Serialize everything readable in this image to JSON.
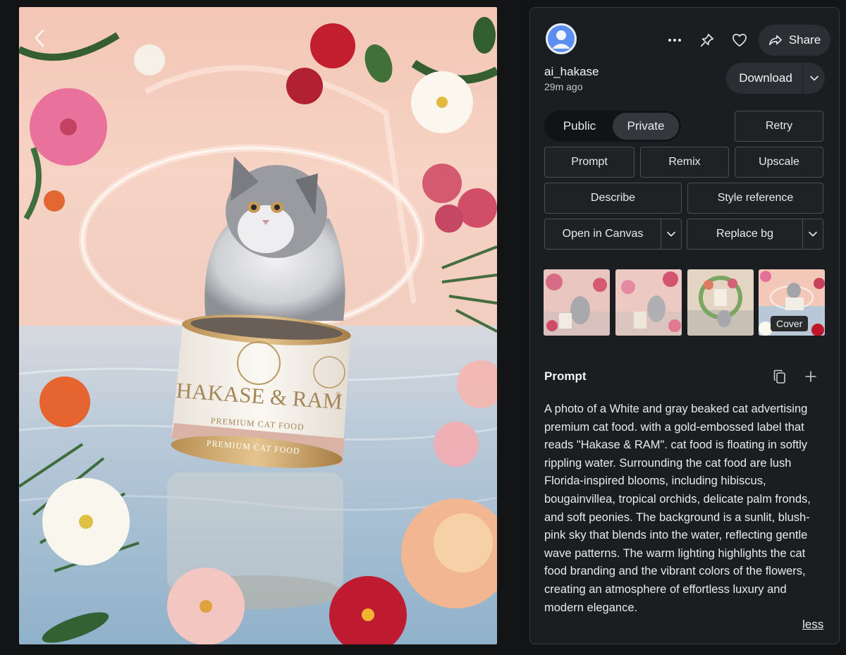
{
  "user": {
    "name": "ai_hakase",
    "time": "29m ago"
  },
  "actions": {
    "share": "Share",
    "download": "Download"
  },
  "visibility": {
    "options": [
      "Public",
      "Private"
    ],
    "selected": "Private"
  },
  "buttons": {
    "retry": "Retry",
    "prompt": "Prompt",
    "remix": "Remix",
    "upscale": "Upscale",
    "describe": "Describe",
    "style_reference": "Style reference",
    "open_in_canvas": "Open in Canvas",
    "replace_bg": "Replace bg"
  },
  "thumbnails": {
    "cover_label": "Cover",
    "count": 4
  },
  "image": {
    "brand": "HAKASE & RAM",
    "registered": "®",
    "label_line1": "PREMIUM CAT FOOD",
    "label_line2": "PREMIUM CAT FOOD"
  },
  "prompt": {
    "heading": "Prompt",
    "text": "A photo of a White and gray beaked cat advertising premium cat food. with a gold-embossed label that reads \"Hakase & RAM\". cat food   is floating in softly rippling water. Surrounding the cat food   are lush Florida-inspired blooms, including hibiscus, bougainvillea, tropical orchids, delicate palm fronds, and soft peonies. The background is a sunlit, blush-pink sky that blends into the water, reflecting gentle wave patterns. The warm lighting highlights the cat food branding and the vibrant colors of the flowers, creating an atmosphere of effortless luxury and modern elegance.",
    "less": "less"
  },
  "icons": [
    "back-arrow-icon",
    "more-icon",
    "pin-icon",
    "heart-icon",
    "share-icon",
    "chevron-down-icon",
    "copy-icon",
    "plus-icon",
    "user-icon"
  ],
  "colors": {
    "background": "#121416",
    "panel": "#1b1e21",
    "button_border": "#4a4f55",
    "toggle_active": "#34383d"
  }
}
